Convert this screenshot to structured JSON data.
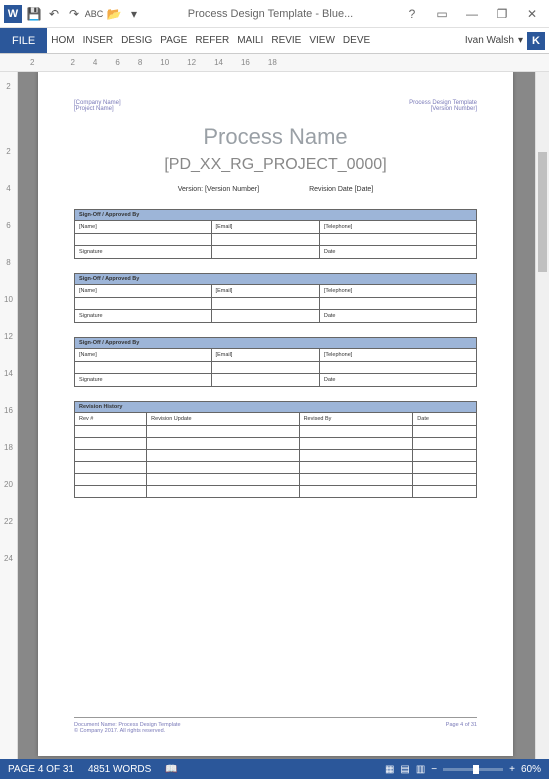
{
  "titlebar": {
    "title": "Process Design Template - Blue..."
  },
  "ribbon": {
    "file": "FILE",
    "tabs": [
      "HOM",
      "INSER",
      "DESIG",
      "PAGE",
      "REFER",
      "MAILI",
      "REVIE",
      "VIEW",
      "DEVE"
    ],
    "user": "Ivan Walsh",
    "user_initial": "K"
  },
  "ruler": {
    "h": [
      "2",
      "",
      "2",
      "4",
      "6",
      "8",
      "10",
      "12",
      "14",
      "16",
      "18"
    ],
    "v": [
      "2",
      "",
      "2",
      "4",
      "6",
      "8",
      "10",
      "12",
      "14",
      "16",
      "18",
      "20",
      "22",
      "24"
    ]
  },
  "doc": {
    "header": {
      "left1": "[Company Name]",
      "left2": "[Project Name]",
      "right1": "Process Design Template",
      "right2": "[Version Number]"
    },
    "title": "Process Name",
    "subtitle": "[PD_XX_RG_PROJECT_0000]",
    "meta": {
      "version": "Version: [Version Number]",
      "revision": "Revision Date [Date]"
    },
    "signoff": {
      "header": "Sign-Off / Approved By",
      "cols": [
        "[Name]",
        "[Email]",
        "[Telephone]"
      ],
      "row2": [
        "Signature",
        "",
        "Date"
      ]
    },
    "history": {
      "header": "Revision History",
      "cols": [
        "Rev #",
        "Revision Update",
        "Revised By",
        "Date"
      ]
    },
    "footer": {
      "doc": "Document Name: Process Design Template",
      "copy": "© Company 2017. All rights reserved.",
      "page": "Page 4 of 31"
    }
  },
  "status": {
    "page": "PAGE 4 OF 31",
    "words": "4851 WORDS",
    "zoom": "60%"
  }
}
